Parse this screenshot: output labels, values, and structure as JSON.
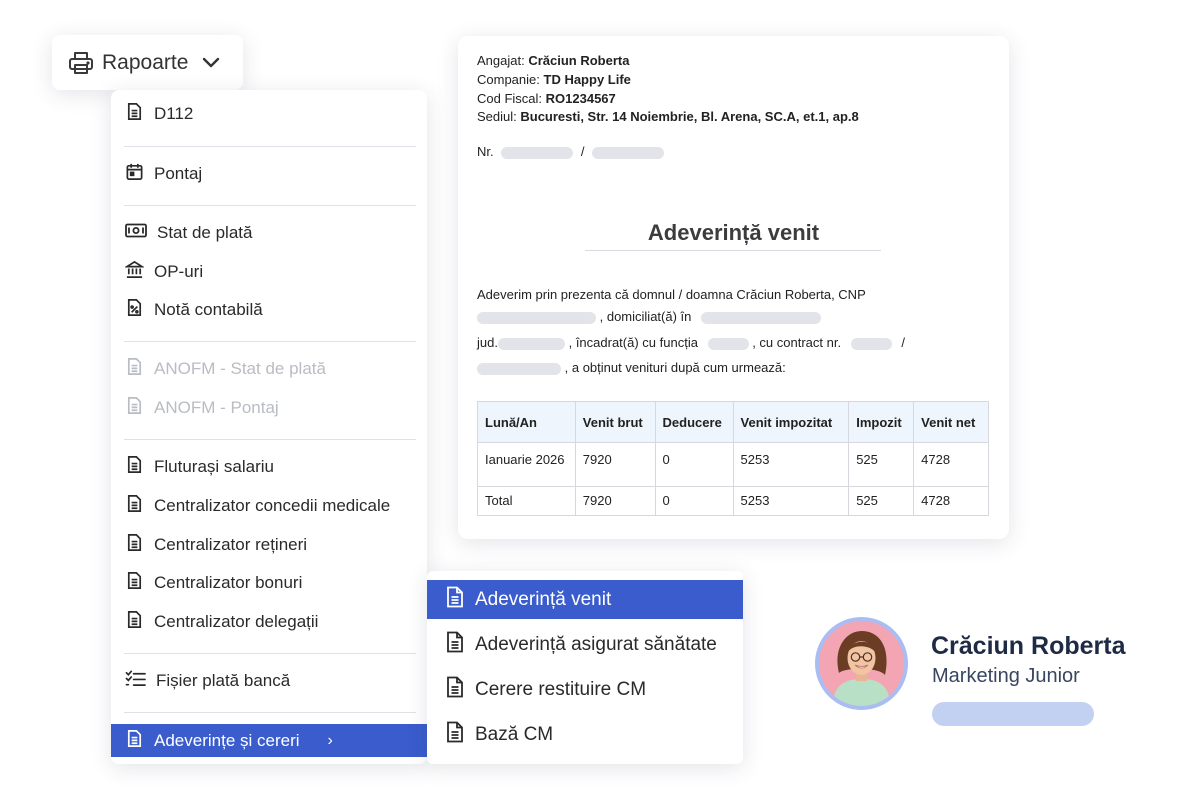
{
  "rapoarte": {
    "label": "Rapoarte",
    "icon": "printer-icon"
  },
  "menu": {
    "items": [
      {
        "label": "D112",
        "icon": "document-icon"
      },
      {
        "label": "Pontaj",
        "icon": "calendar-icon"
      },
      {
        "label": "Stat de plată",
        "icon": "money-icon"
      },
      {
        "label": "OP-uri",
        "icon": "bank-icon"
      },
      {
        "label": "Notă contabilă",
        "icon": "percent-document-icon"
      },
      {
        "label": "ANOFM - Stat de plată",
        "icon": "document-icon",
        "disabled": true
      },
      {
        "label": "ANOFM - Pontaj",
        "icon": "document-icon",
        "disabled": true
      },
      {
        "label": "Fluturași salariu",
        "icon": "document-icon"
      },
      {
        "label": "Centralizator concedii medicale",
        "icon": "document-icon"
      },
      {
        "label": "Centralizator rețineri",
        "icon": "document-icon"
      },
      {
        "label": "Centralizator bonuri",
        "icon": "document-icon"
      },
      {
        "label": "Centralizator delegații",
        "icon": "document-icon"
      },
      {
        "label": "Fișier plată bancă",
        "icon": "checklist-icon"
      },
      {
        "label": "Adeverințe și cereri",
        "icon": "document-icon",
        "active": true,
        "arrow": "›"
      }
    ]
  },
  "submenu": {
    "items": [
      {
        "label": "Adeverință venit",
        "active": true
      },
      {
        "label": "Adeverință asigurat sănătate"
      },
      {
        "label": "Cerere restituire CM"
      },
      {
        "label": "Bază CM"
      }
    ]
  },
  "document": {
    "angajat_label": "Angajat:",
    "angajat_value": "Crăciun Roberta",
    "companie_label": "Companie:",
    "companie_value": "TD Happy Life",
    "cod_fiscal_label": "Cod Fiscal:",
    "cod_fiscal_value": "RO1234567",
    "sediul_label": "Sediul:",
    "sediul_value": "Bucuresti, Str. 14 Noiembrie, Bl. Arena, SC.A, et.1, ap.8",
    "nr_label": "Nr.",
    "nr_sep": "/",
    "title": "Adeverință venit",
    "body_line1": "Adeverim prin prezenta că domnul / doamna Crăciun Roberta, CNP",
    "body_domiciliat": ", domiciliat(ă) în",
    "body_jud": "jud.",
    "body_incadrat": ", încadrat(ă) cu funcția",
    "body_contract": ", cu contract nr.",
    "body_slash": "/",
    "body_obtinut": ", a obținut venituri după cum urmează:",
    "table": {
      "headers": [
        "Lună/An",
        "Venit brut",
        "Deducere",
        "Venit impozitat",
        "Impozit",
        "Venit net"
      ],
      "rows": [
        [
          "Ianuarie 2026",
          "7920",
          "0",
          "5253",
          "525",
          "4728"
        ],
        [
          "Total",
          "7920",
          "0",
          "5253",
          "525",
          "4728"
        ]
      ]
    }
  },
  "profile": {
    "name": "Crăciun Roberta",
    "role": "Marketing Junior"
  },
  "colors": {
    "accent": "#3a5ccc",
    "avatar_ring": "#a9bdf3",
    "pill": "#c2d1f1",
    "table_header_bg": "#eef5fc"
  }
}
